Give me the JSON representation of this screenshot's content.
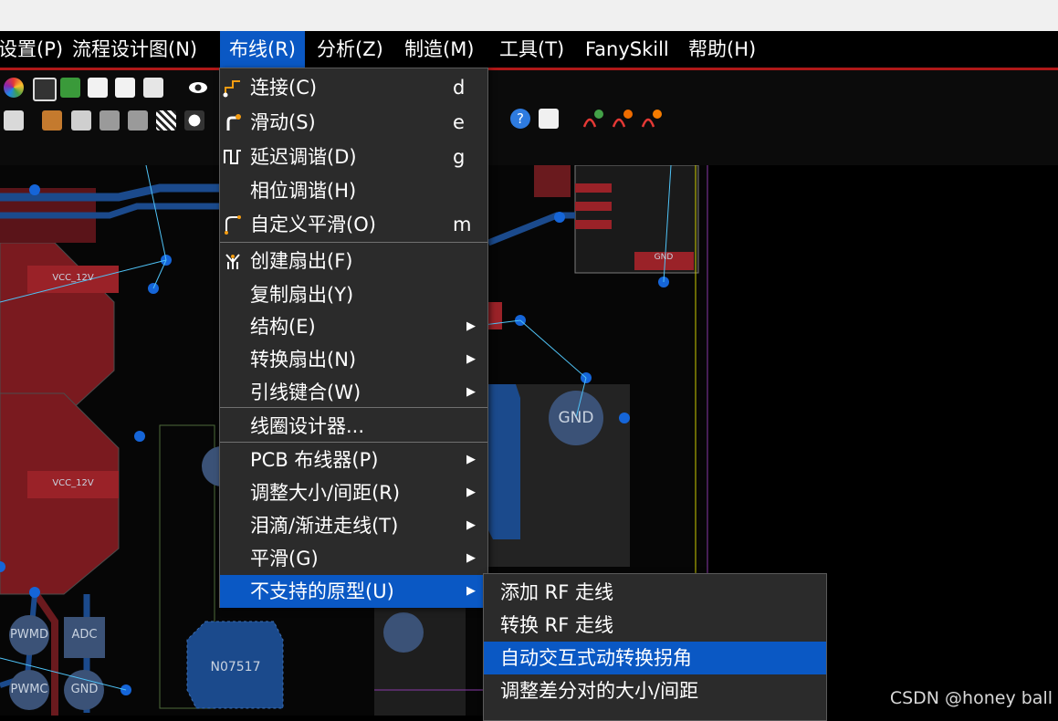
{
  "menubar": {
    "items": [
      "设置(P)",
      "流程设计图(N)",
      "布线(R)",
      "分析(Z)",
      "制造(M)",
      "工具(T)",
      "FanySkill",
      "帮助(H)"
    ],
    "active_index": 2
  },
  "route_menu": {
    "items": [
      {
        "label": "连接(C)",
        "shortcut": "d",
        "icon": "connect-icon"
      },
      {
        "label": "滑动(S)",
        "shortcut": "e",
        "icon": "slide-icon"
      },
      {
        "label": "延迟调谐(D)",
        "shortcut": "g",
        "icon": "delay-tune-icon"
      },
      {
        "label": "相位调谐(H)",
        "shortcut": ""
      },
      {
        "label": "自定义平滑(O)",
        "shortcut": "m",
        "icon": "custom-smooth-icon"
      },
      {
        "label": "创建扇出(F)",
        "shortcut": "",
        "icon": "fanout-icon"
      },
      {
        "label": "复制扇出(Y)",
        "shortcut": ""
      },
      {
        "label": "结构(E)",
        "submenu": true
      },
      {
        "label": "转换扇出(N)",
        "submenu": true
      },
      {
        "label": "引线键合(W)",
        "submenu": true
      },
      {
        "label": "线圈设计器...",
        "shortcut": ""
      },
      {
        "label": "PCB 布线器(P)",
        "submenu": true
      },
      {
        "label": "调整大小/间距(R)",
        "submenu": true
      },
      {
        "label": "泪滴/渐进走线(T)",
        "submenu": true
      },
      {
        "label": "平滑(G)",
        "submenu": true
      },
      {
        "label": "不支持的原型(U)",
        "submenu": true
      }
    ],
    "highlighted_index": 15
  },
  "prototype_submenu": {
    "items": [
      "添加 RF 走线",
      "转换 RF 走线",
      "自动交互式动转换拐角",
      "调整差分对的大小/间距"
    ],
    "highlighted_index": 2
  },
  "canvas": {
    "labels": {
      "vcc1": "VCC_12V",
      "vcc2": "VCC_12V",
      "gnd_pad": "GND",
      "pwmd": "PWMD",
      "adc": "ADC",
      "pwmc": "PWMC",
      "gnd_small": "GND",
      "n07517": "N07517",
      "gnd_tag": "GND"
    }
  },
  "watermark": "CSDN @honey ball",
  "colors": {
    "accent": "#0a58c4",
    "menu_bg": "#2b2b2b",
    "menubar_bg": "#000000",
    "menubar_line": "#b01818"
  }
}
